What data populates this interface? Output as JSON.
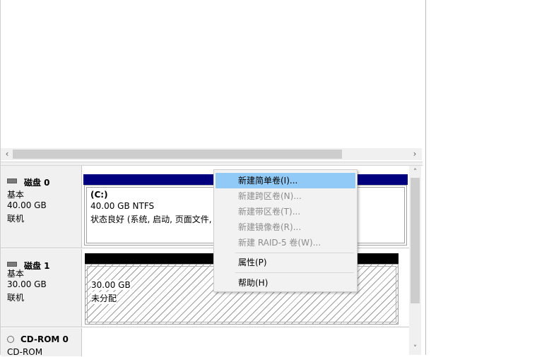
{
  "disks": [
    {
      "name": "磁盘 0",
      "type": "基本",
      "size": "40.00 GB",
      "status": "联机",
      "partition": {
        "title": "(C:)",
        "size_fs": "40.00 GB NTFS",
        "status": "状态良好 (系统, 启动, 页面文件, 活"
      }
    },
    {
      "name": "磁盘 1",
      "type": "基本",
      "size": "30.00 GB",
      "status": "联机",
      "partition": {
        "size": "30.00 GB",
        "status": "未分配"
      }
    },
    {
      "name": "CD-ROM 0",
      "type": "CD-ROM"
    }
  ],
  "context_menu": {
    "items": [
      {
        "label": "新建简单卷(I)...",
        "state": "highlighted"
      },
      {
        "label": "新建跨区卷(N)...",
        "state": "disabled"
      },
      {
        "label": "新建带区卷(T)...",
        "state": "disabled"
      },
      {
        "label": "新建镜像卷(R)...",
        "state": "disabled"
      },
      {
        "label": "新建 RAID-5 卷(W)...",
        "state": "disabled"
      },
      {
        "label": "属性(P)",
        "state": "enabled"
      },
      {
        "label": "帮助(H)",
        "state": "enabled"
      }
    ]
  },
  "icons": {
    "disk": "disk-drive-icon",
    "cdrom": "cdrom-icon",
    "scroll_left": "chevron-left-icon",
    "scroll_right": "chevron-right-icon",
    "scroll_up": "chevron-up-icon",
    "scroll_down": "chevron-down-icon"
  },
  "colors": {
    "primary_partition_bar": "#00007f",
    "unallocated_bar": "#000000",
    "menu_highlight": "#91c9f7",
    "disabled_text": "#8d8d8d"
  }
}
